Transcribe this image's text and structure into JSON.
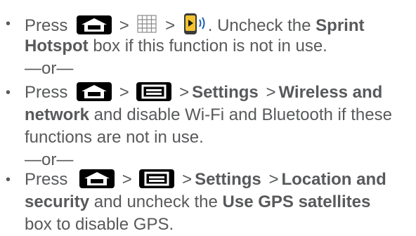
{
  "bullet": "•",
  "separator": ">",
  "icons": {
    "home": "home-key-icon",
    "menu": "menu-key-icon",
    "applications": "applications-grid-icon",
    "hotspot": "sprint-hotspot-icon"
  },
  "items": [
    {
      "lines": [
        {
          "press": "Press",
          "after": ". Uncheck the ",
          "bold": "Sprint"
        },
        {
          "bold": "Hotspot",
          "rest": " box if this function is not in use."
        }
      ]
    },
    {
      "lines": [
        {
          "press": "Press",
          "bold_settings": "Settings",
          "bold_wireless": "Wireless and"
        },
        {
          "bold": "network",
          "rest": " and disable Wi-Fi and Bluetooth if these"
        },
        {
          "rest": "functions are not in use."
        }
      ]
    },
    {
      "lines": [
        {
          "press": "Press",
          "bold_settings": "Settings",
          "bold_location": "Location and"
        },
        {
          "bold": "security",
          "mid": " and uncheck the ",
          "bold2": "Use GPS satellites"
        },
        {
          "rest": "box to disable GPS."
        }
      ]
    }
  ],
  "or_text": "—or—"
}
